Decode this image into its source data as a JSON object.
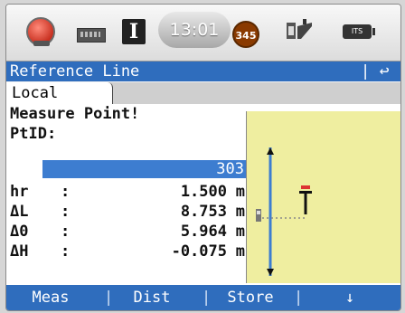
{
  "status": {
    "time": "13:01",
    "mode": "I",
    "badge": "345",
    "battery_label": "ITS"
  },
  "title": {
    "text": "Reference Line",
    "separator": "|",
    "back_glyph": "↩"
  },
  "tab": {
    "label": "Local"
  },
  "body": {
    "prompt": "Measure Point!",
    "ptid_label": "PtID:",
    "ptid_value": "303"
  },
  "rows": [
    {
      "key": "hr",
      "colon": ":",
      "value": "1.500",
      "unit": "m"
    },
    {
      "key": "ΔL",
      "colon": ":",
      "value": "8.753",
      "unit": "m"
    },
    {
      "key": "Δ0",
      "colon": ":",
      "value": "5.964",
      "unit": "m"
    },
    {
      "key": "ΔH",
      "colon": ":",
      "value": "-0.075",
      "unit": "m"
    }
  ],
  "softkeys": {
    "meas": "Meas",
    "dist": "Dist",
    "store": "Store",
    "more": "↓",
    "sep": "|"
  },
  "colors": {
    "accent": "#2f6dbd",
    "graphic_bg": "#efeea0"
  }
}
